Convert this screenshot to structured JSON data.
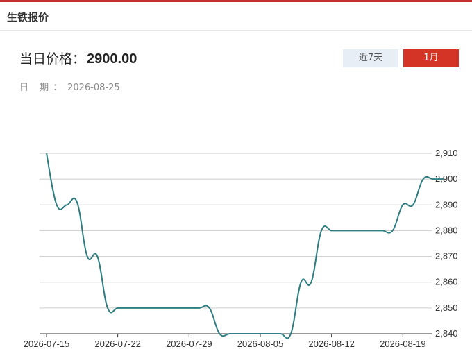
{
  "header": {
    "title": "生铁报价"
  },
  "price": {
    "label": "当日价格：",
    "value": "2900.00"
  },
  "date": {
    "label": "日 期：",
    "value": "2026-08-25"
  },
  "range_buttons": [
    {
      "label": "近7天",
      "active": false
    },
    {
      "label": "1月",
      "active": true
    }
  ],
  "colors": {
    "accent": "#d33425",
    "line": "#2e7d80",
    "inactive_button": "#e8eef5"
  },
  "chart_data": {
    "type": "line",
    "x": [
      "2026-07-15",
      "2026-07-16",
      "2026-07-17",
      "2026-07-18",
      "2026-07-19",
      "2026-07-20",
      "2026-07-21",
      "2026-07-22",
      "2026-07-23",
      "2026-07-24",
      "2026-07-25",
      "2026-07-26",
      "2026-07-27",
      "2026-07-28",
      "2026-07-29",
      "2026-07-30",
      "2026-07-31",
      "2026-08-01",
      "2026-08-02",
      "2026-08-03",
      "2026-08-04",
      "2026-08-05",
      "2026-08-06",
      "2026-08-07",
      "2026-08-08",
      "2026-08-09",
      "2026-08-10",
      "2026-08-11",
      "2026-08-12",
      "2026-08-13",
      "2026-08-14",
      "2026-08-15",
      "2026-08-16",
      "2026-08-17",
      "2026-08-18",
      "2026-08-19",
      "2026-08-20",
      "2026-08-21",
      "2026-08-22",
      "2026-08-23"
    ],
    "values": [
      2910,
      2890,
      2890,
      2891,
      2870,
      2870,
      2850,
      2850,
      2850,
      2850,
      2850,
      2850,
      2850,
      2850,
      2850,
      2850,
      2850,
      2840,
      2840,
      2840,
      2840,
      2840,
      2840,
      2840,
      2840,
      2860,
      2860,
      2880,
      2880,
      2880,
      2880,
      2880,
      2880,
      2880,
      2880,
      2890,
      2890,
      2900,
      2900,
      2900
    ],
    "x_ticks": [
      "2026-07-15",
      "2026-07-22",
      "2026-07-29",
      "2026-08-05",
      "2026-08-12",
      "2026-08-19"
    ],
    "y_ticks": [
      "2,840",
      "2,850",
      "2,860",
      "2,870",
      "2,880",
      "2,890",
      "2,900",
      "2,910"
    ],
    "ylim": [
      2840,
      2910
    ],
    "grid": "horizontal",
    "legend": "none"
  }
}
